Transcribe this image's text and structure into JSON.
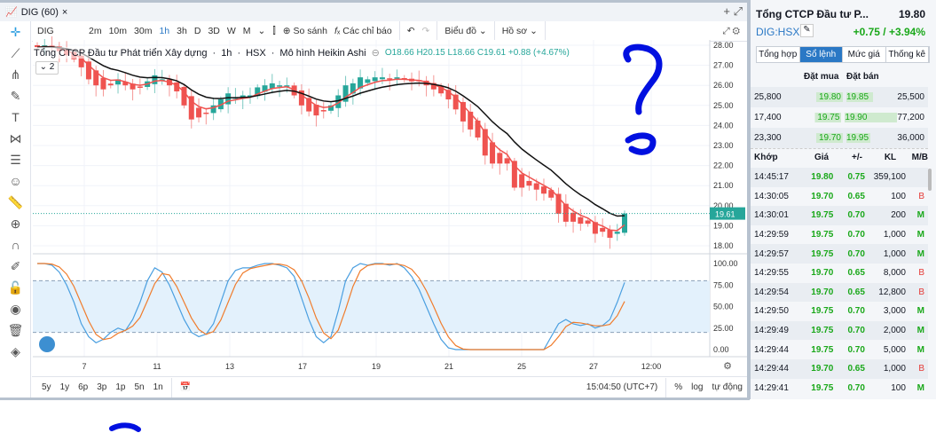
{
  "window": {
    "tab_title": "DIG (60)",
    "close": "×"
  },
  "toolbar": {
    "symbol": "DIG",
    "intervals": [
      "2m",
      "10m",
      "30m",
      "1h",
      "3h",
      "D",
      "3D",
      "W",
      "M"
    ],
    "active_interval": "1h",
    "compare": "So sánh",
    "indicators": "Các chỉ báo",
    "chart_type": "Biểu đồ",
    "profile": "Hồ sơ"
  },
  "legend": {
    "name": "Tổng CTCP Đầu tư Phát triển Xây dựng",
    "interval": "1h",
    "exchange": "HSX",
    "style": "Mô hình Heikin Ashi",
    "open": "O18.66",
    "high": "H20.15",
    "low": "L18.66",
    "close": "C19.61",
    "change": "+0.88 (+4.67%)",
    "collapse_count": "2"
  },
  "colors": {
    "up": "#26a69a",
    "down": "#ef5350",
    "ema_fast": "#ef5350",
    "ema_slow": "#111111",
    "stoch_k": "#4a9fe0",
    "stoch_d": "#f07c2c",
    "accent": "#2a78c5",
    "green": "#1aa81a"
  },
  "chart_data": [
    {
      "type": "candlestick",
      "style": "Heikin Ashi",
      "ylim": [
        17.7,
        28.3
      ],
      "y_ticks": [
        "28.00",
        "27.00",
        "26.00",
        "25.00",
        "24.00",
        "23.00",
        "22.00",
        "21.00",
        "20.00",
        "19.00",
        "18.00"
      ],
      "x_ticks": [
        "7",
        "11",
        "13",
        "17",
        "19",
        "21",
        "25",
        "27",
        "12:00"
      ],
      "last_price_label": "19.61",
      "closes": [
        27.9,
        28.0,
        27.9,
        27.7,
        27.5,
        27.3,
        26.9,
        26.3,
        26.0,
        25.8,
        26.0,
        26.3,
        26.0,
        25.8,
        25.9,
        26.2,
        26.5,
        26.3,
        26.0,
        25.7,
        25.0,
        24.3,
        24.4,
        24.6,
        25.0,
        25.3,
        25.6,
        25.4,
        25.5,
        25.5,
        25.9,
        26.0,
        26.1,
        26.0,
        26.0,
        25.5,
        25.0,
        24.7,
        24.5,
        24.7,
        25.0,
        25.5,
        26.0,
        26.1,
        26.4,
        26.3,
        26.4,
        26.4,
        26.3,
        26.4,
        26.3,
        26.2,
        26.2,
        26.0,
        25.8,
        25.6,
        25.3,
        24.8,
        24.2,
        23.8,
        23.4,
        22.5,
        22.1,
        22.1,
        22.1,
        20.9,
        20.9,
        21.0,
        20.8,
        20.6,
        20.4,
        19.6,
        19.2,
        19.2,
        19.1,
        19.1,
        18.6,
        18.7,
        18.4,
        18.7,
        19.61
      ]
    },
    {
      "type": "line",
      "name": "Stochastic",
      "ylim": [
        0,
        100
      ],
      "y_ticks": [
        "100.00",
        "75.00",
        "50.00",
        "25.00",
        "0.00"
      ],
      "band": [
        20,
        80
      ],
      "k": [
        100,
        100,
        98,
        90,
        75,
        55,
        30,
        15,
        8,
        12,
        20,
        25,
        22,
        35,
        55,
        80,
        95,
        90,
        75,
        55,
        35,
        20,
        15,
        18,
        30,
        55,
        80,
        92,
        95,
        95,
        98,
        100,
        100,
        98,
        95,
        85,
        60,
        35,
        15,
        8,
        15,
        45,
        80,
        95,
        100,
        98,
        100,
        100,
        98,
        100,
        95,
        85,
        70,
        50,
        30,
        12,
        2,
        0,
        0,
        0,
        0,
        0,
        0,
        0,
        0,
        0,
        0,
        0,
        0,
        0,
        15,
        30,
        35,
        30,
        28,
        30,
        25,
        28,
        35,
        55,
        78
      ]
    }
  ],
  "bottombar": {
    "ranges": [
      "5y",
      "1y",
      "6p",
      "3p",
      "1p",
      "5n",
      "1n"
    ],
    "time": "15:04:50 (UTC+7)",
    "percent": "%",
    "log": "log",
    "auto": "tự động"
  },
  "panel": {
    "name": "Tổng CTCP Đầu tư P...",
    "price": "19.80",
    "ticker": "DIG:HSX",
    "change": "+0.75 / +3.94%",
    "tabs": [
      "Tổng hợp",
      "Sổ lệnh",
      "Mức giá",
      "Thống kê"
    ],
    "book_headers": {
      "bid": "Đặt mua",
      "ask": "Đặt bán"
    },
    "book": [
      {
        "bid_vol": "25,800",
        "bid": "19.80",
        "ask": "19.85",
        "ask_vol": "25,500"
      },
      {
        "bid_vol": "17,400",
        "bid": "19.75",
        "ask": "19.90",
        "ask_vol": "77,200"
      },
      {
        "bid_vol": "23,300",
        "bid": "19.70",
        "ask": "19.95",
        "ask_vol": "36,000"
      }
    ],
    "trade_headers": {
      "time": "Khớp",
      "price": "Giá",
      "chg": "+/-",
      "vol": "KL",
      "side": "M/B"
    },
    "trades": [
      {
        "time": "14:45:17",
        "price": "19.80",
        "chg": "0.75",
        "vol": "359,100",
        "side": ""
      },
      {
        "time": "14:30:05",
        "price": "19.70",
        "chg": "0.65",
        "vol": "100",
        "side": "B"
      },
      {
        "time": "14:30:01",
        "price": "19.75",
        "chg": "0.70",
        "vol": "200",
        "side": "M"
      },
      {
        "time": "14:29:59",
        "price": "19.75",
        "chg": "0.70",
        "vol": "1,000",
        "side": "M"
      },
      {
        "time": "14:29:57",
        "price": "19.75",
        "chg": "0.70",
        "vol": "1,000",
        "side": "M"
      },
      {
        "time": "14:29:55",
        "price": "19.70",
        "chg": "0.65",
        "vol": "8,000",
        "side": "B"
      },
      {
        "time": "14:29:54",
        "price": "19.70",
        "chg": "0.65",
        "vol": "12,800",
        "side": "B"
      },
      {
        "time": "14:29:50",
        "price": "19.75",
        "chg": "0.70",
        "vol": "3,000",
        "side": "M"
      },
      {
        "time": "14:29:49",
        "price": "19.75",
        "chg": "0.70",
        "vol": "2,000",
        "side": "M"
      },
      {
        "time": "14:29:44",
        "price": "19.75",
        "chg": "0.70",
        "vol": "5,000",
        "side": "M"
      },
      {
        "time": "14:29:44",
        "price": "19.70",
        "chg": "0.65",
        "vol": "1,000",
        "side": "B"
      },
      {
        "time": "14:29:41",
        "price": "19.75",
        "chg": "0.70",
        "vol": "100",
        "side": "M"
      }
    ]
  }
}
